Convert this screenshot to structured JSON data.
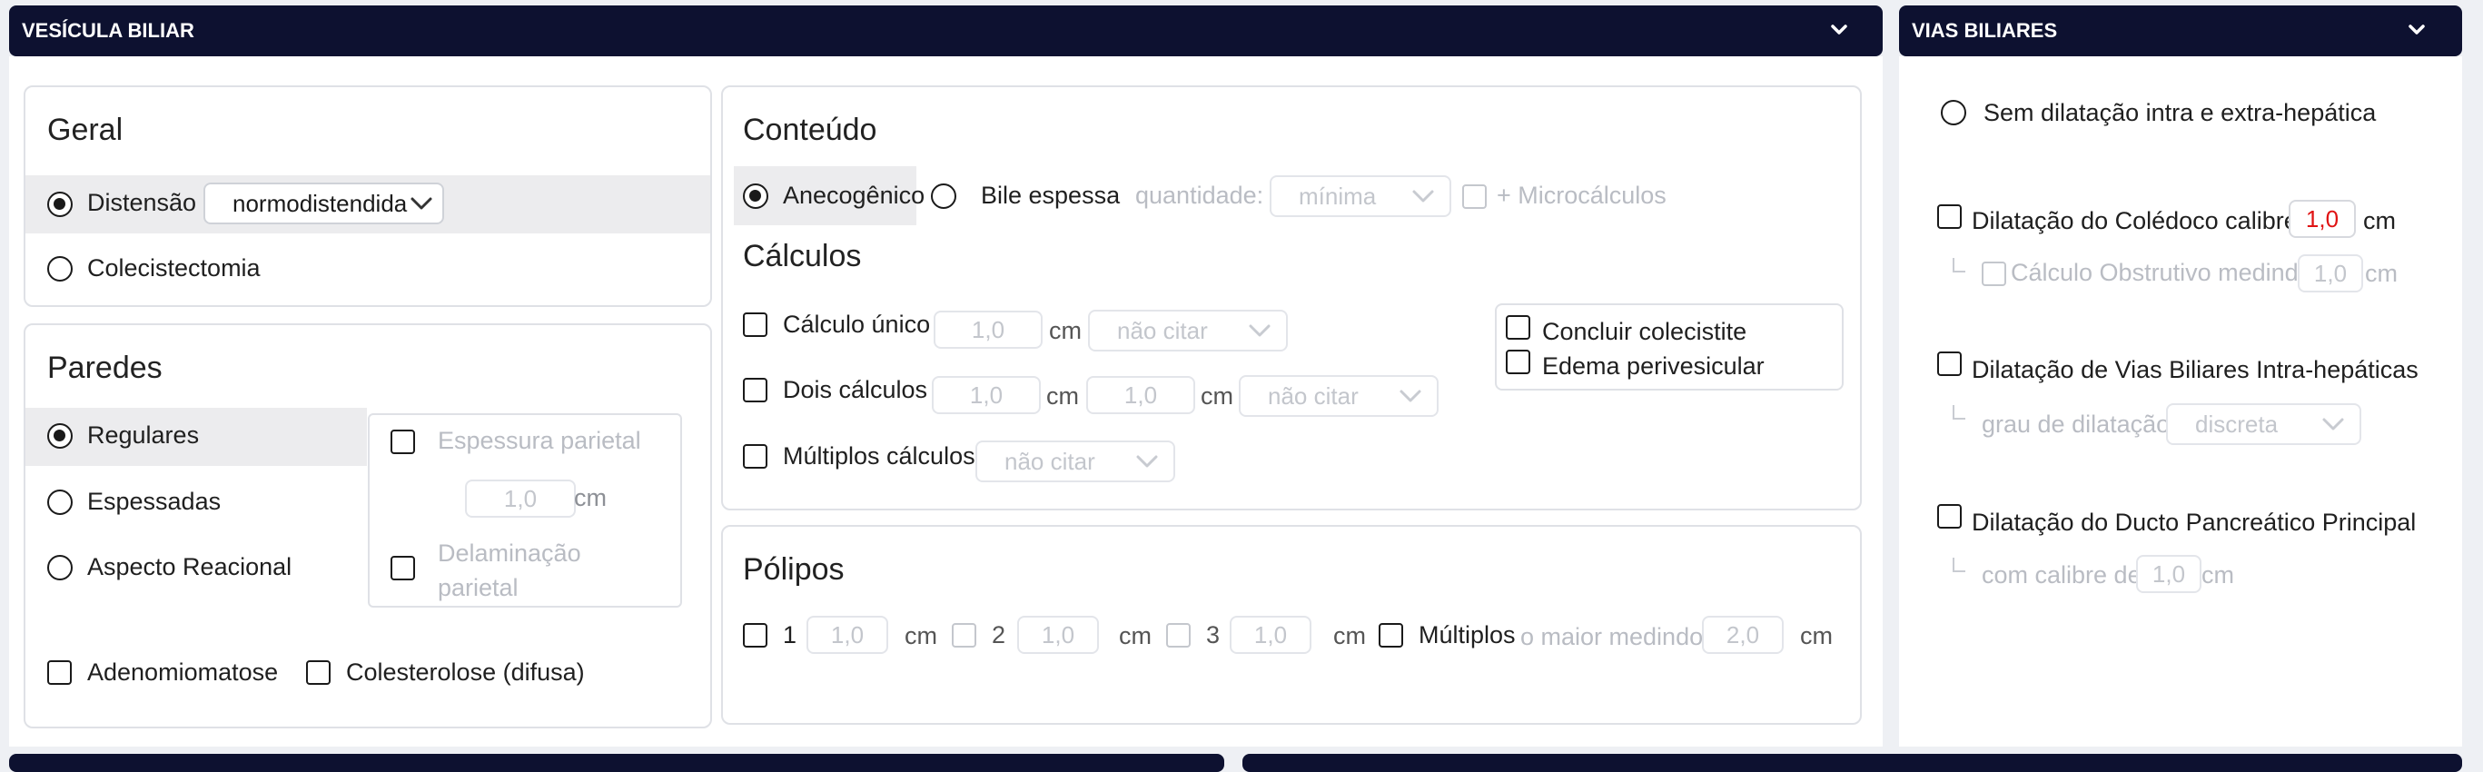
{
  "vesicula": {
    "title": "VESÍCULA BILIAR",
    "geral": {
      "title": "Geral",
      "distensao_label": "Distensão",
      "distensao_value": "normodistendida",
      "colecistectomia_label": "Colecistectomia"
    },
    "paredes": {
      "title": "Paredes",
      "regulares": "Regulares",
      "espessadas": "Espessadas",
      "aspecto_reacional": "Aspecto Reacional",
      "espessura_parietal": "Espessura parietal",
      "espessura_value": "1,0",
      "unit": "cm",
      "delaminacao_line1": "Delaminação",
      "delaminacao_line2": "parietal",
      "adenomiomatose": "Adenomiomatose",
      "colesterolose": "Colesterolose (difusa)"
    },
    "conteudo": {
      "title": "Conteúdo",
      "anecogenico": "Anecogênico",
      "bile_espessa": "Bile espessa",
      "quantidade_label": "quantidade:",
      "quantidade_value": "mínima",
      "microcalculos": "+ Microcálculos"
    },
    "calculos": {
      "title": "Cálculos",
      "unico": "Cálculo único",
      "dois": "Dois cálculos",
      "multiplos": "Múltiplos cálculos",
      "value": "1,0",
      "unit": "cm",
      "nao_citar": "não citar",
      "concluir_colecistite": "Concluir colecistite",
      "edema_perivesicular": "Edema perivesicular"
    },
    "polipos": {
      "title": "Pólipos",
      "n1": "1",
      "n2": "2",
      "n3": "3",
      "value": "1,0",
      "unit": "cm",
      "multiplos": "Múltiplos",
      "maior_medindo": "o maior medindo",
      "maior_value": "2,0"
    }
  },
  "vias": {
    "title": "VIAS BILIARES",
    "sem_dilatacao": "Sem dilatação intra e extra-hepática",
    "dilatacao_coledoco": "Dilatação do Colédoco calibre",
    "coledoco_value": "1,0",
    "unit": "cm",
    "calculo_obstrutivo": "Cálculo Obstrutivo medindo",
    "obstrutivo_value": "1,0",
    "dilatacao_intra": "Dilatação de Vias Biliares Intra-hepáticas",
    "grau_label": "grau de dilatação",
    "grau_value": "discreta",
    "dilatacao_ducto": "Dilatação do Ducto Pancreático Principal",
    "calibre_label": "com calibre de",
    "calibre_value": "1,0"
  },
  "colors": {
    "header_bg": "#0d1130",
    "accent_value": "#e01414",
    "disabled_text": "#c3c6cc"
  }
}
